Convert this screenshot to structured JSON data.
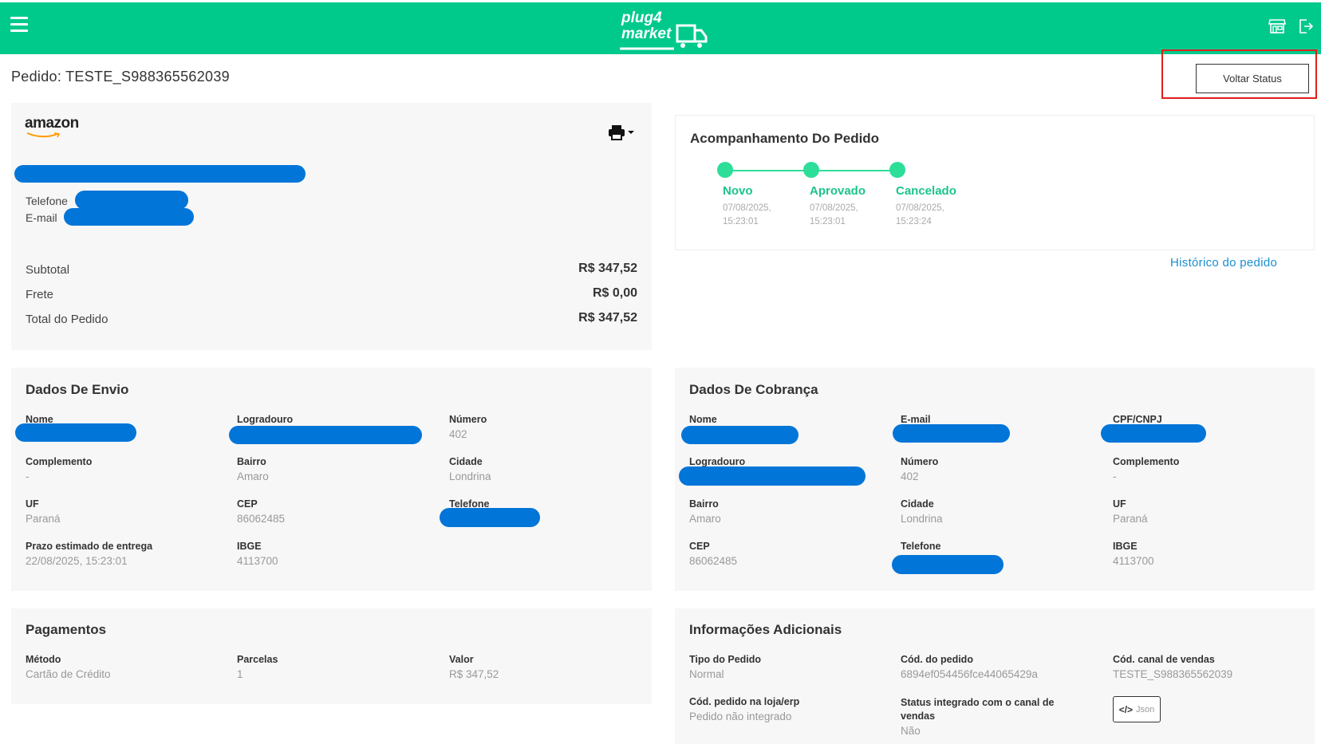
{
  "header": {
    "logo_line1": "plug4",
    "logo_line2": "market",
    "menu_icon": "hamburger-menu-icon",
    "store_icon": "store-icon",
    "logout_icon": "logout-icon"
  },
  "order": {
    "title": "Pedido: TESTE_S988365562039",
    "back_status_label": "Voltar Status"
  },
  "summary_card": {
    "marketplace_logo": "amazon",
    "print_icon": "printer-icon",
    "phone_label": "Telefone",
    "email_label": "E-mail",
    "rows": [
      {
        "label": "Subtotal",
        "value": "R$ 347,52"
      },
      {
        "label": "Frete",
        "value": "R$ 0,00"
      },
      {
        "label": "Total do Pedido",
        "value": "R$ 347,52"
      }
    ]
  },
  "tracking": {
    "title": "Acompanhamento Do Pedido",
    "steps": [
      {
        "name": "Novo",
        "date": "07/08/2025,",
        "time": "15:23:01"
      },
      {
        "name": "Aprovado",
        "date": "07/08/2025,",
        "time": "15:23:01"
      },
      {
        "name": "Cancelado",
        "date": "07/08/2025,",
        "time": "15:23:24"
      }
    ],
    "history_link": "Histórico do pedido"
  },
  "shipping": {
    "title": "Dados De Envio",
    "nome_label": "Nome",
    "logradouro_label": "Logradouro",
    "numero_label": "Número",
    "numero_value": "402",
    "complemento_label": "Complemento",
    "complemento_value": "-",
    "bairro_label": "Bairro",
    "bairro_value": "Amaro",
    "cidade_label": "Cidade",
    "cidade_value": "Londrina",
    "uf_label": "UF",
    "uf_value": "Paraná",
    "cep_label": "CEP",
    "cep_value": "86062485",
    "telefone_label": "Telefone",
    "prazo_label": "Prazo estimado de entrega",
    "prazo_value": "22/08/2025, 15:23:01",
    "ibge_label": "IBGE",
    "ibge_value": "4113700"
  },
  "billing": {
    "title": "Dados De Cobrança",
    "nome_label": "Nome",
    "email_label": "E-mail",
    "cpf_label": "CPF/CNPJ",
    "logradouro_label": "Logradouro",
    "numero_label": "Número",
    "numero_value": "402",
    "complemento_label": "Complemento",
    "complemento_value": "-",
    "bairro_label": "Bairro",
    "bairro_value": "Amaro",
    "cidade_label": "Cidade",
    "cidade_value": "Londrina",
    "uf_label": "UF",
    "uf_value": "Paraná",
    "cep_label": "CEP",
    "cep_value": "86062485",
    "telefone_label": "Telefone",
    "ibge_label": "IBGE",
    "ibge_value": "4113700"
  },
  "payments": {
    "title": "Pagamentos",
    "metodo_label": "Método",
    "metodo_value": "Cartão de Crédito",
    "parcelas_label": "Parcelas",
    "parcelas_value": "1",
    "valor_label": "Valor",
    "valor_value": "R$ 347,52"
  },
  "additional": {
    "title": "Informações Adicionais",
    "tipo_label": "Tipo do Pedido",
    "tipo_value": "Normal",
    "cod_pedido_label": "Cód. do pedido",
    "cod_pedido_value": "6894ef054456fce44065429a",
    "cod_canal_label": "Cód. canal de vendas",
    "cod_canal_value": "TESTE_S988365562039",
    "cod_loja_label": "Cód. pedido na loja/erp",
    "cod_loja_value": "Pedido não integrado",
    "status_label": "Status integrado com o canal de vendas",
    "status_value": "Não",
    "json_label": "Json",
    "json_icon_text": "</>"
  },
  "colors": {
    "brand": "#00c98c",
    "timeline": "#2dde98",
    "link": "#1a8fcf",
    "redaction": "#0275d8",
    "highlight": "#e0201b"
  }
}
